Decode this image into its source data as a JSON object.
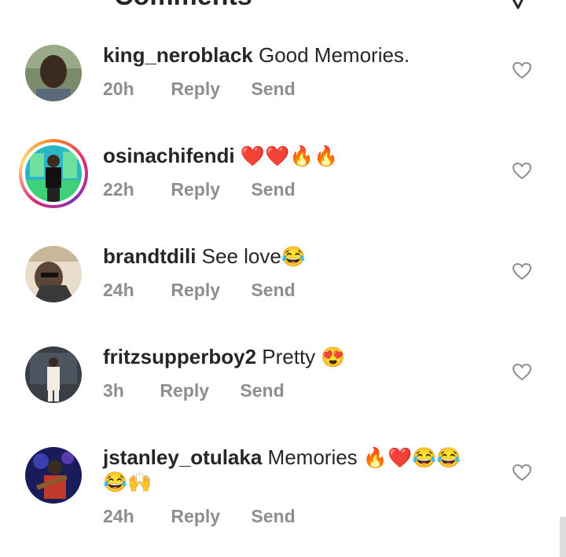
{
  "header": {
    "title": "Comments"
  },
  "comments": [
    {
      "username": "king_neroblack",
      "text": "Good Memories.",
      "emoji": "",
      "emoji2": "",
      "time": "20h",
      "reply": "Reply",
      "send": "Send"
    },
    {
      "username": "osinachifendi",
      "text": "",
      "emoji": "❤️❤️🔥🔥",
      "emoji2": "",
      "time": "22h",
      "reply": "Reply",
      "send": "Send"
    },
    {
      "username": "brandtdili",
      "text": "See love",
      "emoji": "😂",
      "emoji2": "",
      "time": "24h",
      "reply": "Reply",
      "send": "Send"
    },
    {
      "username": "fritzsupperboy2",
      "text": "Pretty",
      "emoji": "😍",
      "emoji2": "",
      "time": "3h",
      "reply": "Reply",
      "send": "Send"
    },
    {
      "username": "jstanley_otulaka",
      "text": "Memories",
      "emoji": "🔥❤️😂😂",
      "emoji2": "😂🙌",
      "time": "24h",
      "reply": "Reply",
      "send": "Send"
    }
  ],
  "colors": {
    "text": "#262626",
    "meta": "#8e8e8e",
    "heart_outline": "#8e8e8e"
  },
  "icons": [
    "back-arrow-icon",
    "send-icon",
    "heart-icon"
  ]
}
